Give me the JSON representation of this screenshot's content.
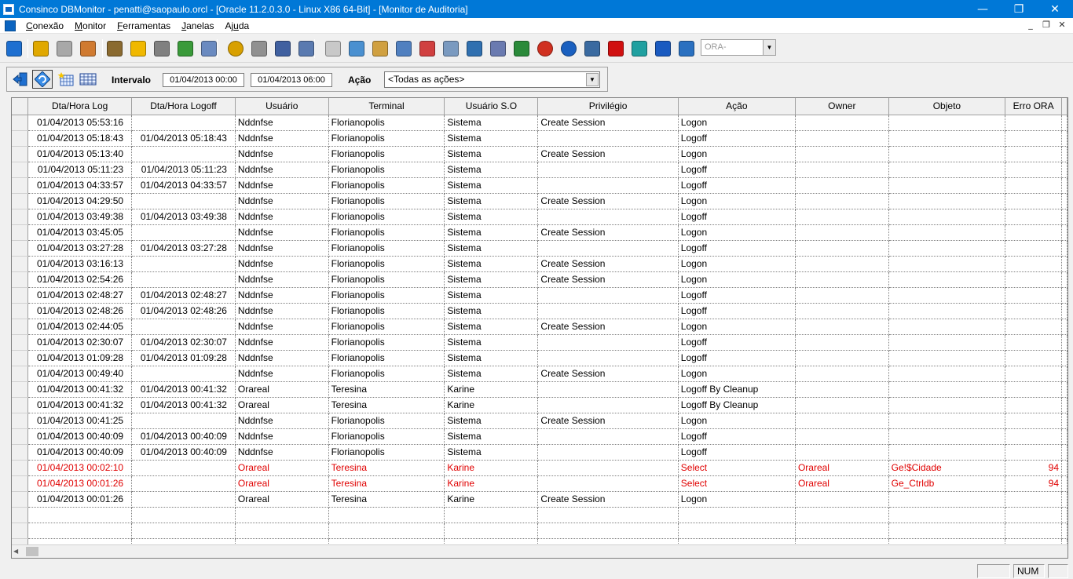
{
  "window": {
    "title": "Consinco DBMonitor - penatti@saopaulo.orcl - [Oracle 11.2.0.3.0 - Linux X86 64-Bit] - [Monitor de Auditoria]",
    "minimize": "—",
    "restore": "❐",
    "close": "✕"
  },
  "menu": {
    "items": [
      {
        "underline": "C",
        "rest": "onexão"
      },
      {
        "underline": "M",
        "rest": "onitor"
      },
      {
        "underline": "F",
        "rest": "erramentas"
      },
      {
        "underline": "J",
        "rest": "anelas"
      },
      {
        "pre": "Aj",
        "underline": "u",
        "rest": "da"
      }
    ],
    "mdi_min": "_",
    "mdi_restore": "❐",
    "mdi_close": "✕"
  },
  "toolbar": {
    "icons": [
      "exit-icon",
      "key-icon",
      "key-gray-icon",
      "user-icon",
      "lock-icon",
      "star-icon",
      "glasses-icon",
      "sessions-icon",
      "objects-icon",
      "clock-icon",
      "database-icon",
      "users-icon",
      "copy-icon",
      "document-icon",
      "preview-icon",
      "report-icon",
      "calendar-icon",
      "calendar-red-icon",
      "list-icon",
      "monitor-icon",
      "group-icon",
      "chart-icon",
      "alarm-icon",
      "info-icon",
      "calculator-icon",
      "oracle-icon",
      "gear-icon",
      "back-icon",
      "help-book-icon"
    ],
    "ora_value": "ORA-"
  },
  "filter": {
    "interval_label": "Intervalo",
    "date_from": "01/04/2013 00:00",
    "date_to": "01/04/2013 06:00",
    "action_label": "Ação",
    "action_value": "<Todas as ações>"
  },
  "grid": {
    "columns": [
      "Dta/Hora Log",
      "Dta/Hora Logoff",
      "Usuário",
      "Terminal",
      "Usuário S.O",
      "Privilégio",
      "Ação",
      "Owner",
      "Objeto",
      "Erro ORA"
    ],
    "rows": [
      {
        "log": "01/04/2013 05:53:16",
        "logoff": "",
        "user": "Nddnfse",
        "terminal": "Florianopolis",
        "os_user": "Sistema",
        "priv": "Create Session",
        "action": "Logon",
        "owner": "",
        "object": "",
        "err": "",
        "error_row": false
      },
      {
        "log": "01/04/2013 05:18:43",
        "logoff": "01/04/2013 05:18:43",
        "user": "Nddnfse",
        "terminal": "Florianopolis",
        "os_user": "Sistema",
        "priv": "",
        "action": "Logoff",
        "owner": "",
        "object": "",
        "err": "",
        "error_row": false
      },
      {
        "log": "01/04/2013 05:13:40",
        "logoff": "",
        "user": "Nddnfse",
        "terminal": "Florianopolis",
        "os_user": "Sistema",
        "priv": "Create Session",
        "action": "Logon",
        "owner": "",
        "object": "",
        "err": "",
        "error_row": false
      },
      {
        "log": "01/04/2013 05:11:23",
        "logoff": "01/04/2013 05:11:23",
        "user": "Nddnfse",
        "terminal": "Florianopolis",
        "os_user": "Sistema",
        "priv": "",
        "action": "Logoff",
        "owner": "",
        "object": "",
        "err": "",
        "error_row": false
      },
      {
        "log": "01/04/2013 04:33:57",
        "logoff": "01/04/2013 04:33:57",
        "user": "Nddnfse",
        "terminal": "Florianopolis",
        "os_user": "Sistema",
        "priv": "",
        "action": "Logoff",
        "owner": "",
        "object": "",
        "err": "",
        "error_row": false
      },
      {
        "log": "01/04/2013 04:29:50",
        "logoff": "",
        "user": "Nddnfse",
        "terminal": "Florianopolis",
        "os_user": "Sistema",
        "priv": "Create Session",
        "action": "Logon",
        "owner": "",
        "object": "",
        "err": "",
        "error_row": false
      },
      {
        "log": "01/04/2013 03:49:38",
        "logoff": "01/04/2013 03:49:38",
        "user": "Nddnfse",
        "terminal": "Florianopolis",
        "os_user": "Sistema",
        "priv": "",
        "action": "Logoff",
        "owner": "",
        "object": "",
        "err": "",
        "error_row": false
      },
      {
        "log": "01/04/2013 03:45:05",
        "logoff": "",
        "user": "Nddnfse",
        "terminal": "Florianopolis",
        "os_user": "Sistema",
        "priv": "Create Session",
        "action": "Logon",
        "owner": "",
        "object": "",
        "err": "",
        "error_row": false
      },
      {
        "log": "01/04/2013 03:27:28",
        "logoff": "01/04/2013 03:27:28",
        "user": "Nddnfse",
        "terminal": "Florianopolis",
        "os_user": "Sistema",
        "priv": "",
        "action": "Logoff",
        "owner": "",
        "object": "",
        "err": "",
        "error_row": false
      },
      {
        "log": "01/04/2013 03:16:13",
        "logoff": "",
        "user": "Nddnfse",
        "terminal": "Florianopolis",
        "os_user": "Sistema",
        "priv": "Create Session",
        "action": "Logon",
        "owner": "",
        "object": "",
        "err": "",
        "error_row": false
      },
      {
        "log": "01/04/2013 02:54:26",
        "logoff": "",
        "user": "Nddnfse",
        "terminal": "Florianopolis",
        "os_user": "Sistema",
        "priv": "Create Session",
        "action": "Logon",
        "owner": "",
        "object": "",
        "err": "",
        "error_row": false
      },
      {
        "log": "01/04/2013 02:48:27",
        "logoff": "01/04/2013 02:48:27",
        "user": "Nddnfse",
        "terminal": "Florianopolis",
        "os_user": "Sistema",
        "priv": "",
        "action": "Logoff",
        "owner": "",
        "object": "",
        "err": "",
        "error_row": false
      },
      {
        "log": "01/04/2013 02:48:26",
        "logoff": "01/04/2013 02:48:26",
        "user": "Nddnfse",
        "terminal": "Florianopolis",
        "os_user": "Sistema",
        "priv": "",
        "action": "Logoff",
        "owner": "",
        "object": "",
        "err": "",
        "error_row": false
      },
      {
        "log": "01/04/2013 02:44:05",
        "logoff": "",
        "user": "Nddnfse",
        "terminal": "Florianopolis",
        "os_user": "Sistema",
        "priv": "Create Session",
        "action": "Logon",
        "owner": "",
        "object": "",
        "err": "",
        "error_row": false
      },
      {
        "log": "01/04/2013 02:30:07",
        "logoff": "01/04/2013 02:30:07",
        "user": "Nddnfse",
        "terminal": "Florianopolis",
        "os_user": "Sistema",
        "priv": "",
        "action": "Logoff",
        "owner": "",
        "object": "",
        "err": "",
        "error_row": false
      },
      {
        "log": "01/04/2013 01:09:28",
        "logoff": "01/04/2013 01:09:28",
        "user": "Nddnfse",
        "terminal": "Florianopolis",
        "os_user": "Sistema",
        "priv": "",
        "action": "Logoff",
        "owner": "",
        "object": "",
        "err": "",
        "error_row": false
      },
      {
        "log": "01/04/2013 00:49:40",
        "logoff": "",
        "user": "Nddnfse",
        "terminal": "Florianopolis",
        "os_user": "Sistema",
        "priv": "Create Session",
        "action": "Logon",
        "owner": "",
        "object": "",
        "err": "",
        "error_row": false
      },
      {
        "log": "01/04/2013 00:41:32",
        "logoff": "01/04/2013 00:41:32",
        "user": "Orareal",
        "terminal": "Teresina",
        "os_user": "Karine",
        "priv": "",
        "action": "Logoff By Cleanup",
        "owner": "",
        "object": "",
        "err": "",
        "error_row": false
      },
      {
        "log": "01/04/2013 00:41:32",
        "logoff": "01/04/2013 00:41:32",
        "user": "Orareal",
        "terminal": "Teresina",
        "os_user": "Karine",
        "priv": "",
        "action": "Logoff By Cleanup",
        "owner": "",
        "object": "",
        "err": "",
        "error_row": false
      },
      {
        "log": "01/04/2013 00:41:25",
        "logoff": "",
        "user": "Nddnfse",
        "terminal": "Florianopolis",
        "os_user": "Sistema",
        "priv": "Create Session",
        "action": "Logon",
        "owner": "",
        "object": "",
        "err": "",
        "error_row": false
      },
      {
        "log": "01/04/2013 00:40:09",
        "logoff": "01/04/2013 00:40:09",
        "user": "Nddnfse",
        "terminal": "Florianopolis",
        "os_user": "Sistema",
        "priv": "",
        "action": "Logoff",
        "owner": "",
        "object": "",
        "err": "",
        "error_row": false
      },
      {
        "log": "01/04/2013 00:40:09",
        "logoff": "01/04/2013 00:40:09",
        "user": "Nddnfse",
        "terminal": "Florianopolis",
        "os_user": "Sistema",
        "priv": "",
        "action": "Logoff",
        "owner": "",
        "object": "",
        "err": "",
        "error_row": false
      },
      {
        "log": "01/04/2013 00:02:10",
        "logoff": "",
        "user": "Orareal",
        "terminal": "Teresina",
        "os_user": "Karine",
        "priv": "",
        "action": "Select",
        "owner": "Orareal",
        "object": "Ge!$Cidade",
        "err": "94",
        "error_row": true
      },
      {
        "log": "01/04/2013 00:01:26",
        "logoff": "",
        "user": "Orareal",
        "terminal": "Teresina",
        "os_user": "Karine",
        "priv": "",
        "action": "Select",
        "owner": "Orareal",
        "object": "Ge_Ctrldb",
        "err": "94",
        "error_row": true
      },
      {
        "log": "01/04/2013 00:01:26",
        "logoff": "",
        "user": "Orareal",
        "terminal": "Teresina",
        "os_user": "Karine",
        "priv": "Create Session",
        "action": "Logon",
        "owner": "",
        "object": "",
        "err": "",
        "error_row": false
      }
    ]
  },
  "statusbar": {
    "num": "NUM"
  },
  "colors": {
    "title_bg": "#0078d7",
    "error_text": "#e00000"
  }
}
